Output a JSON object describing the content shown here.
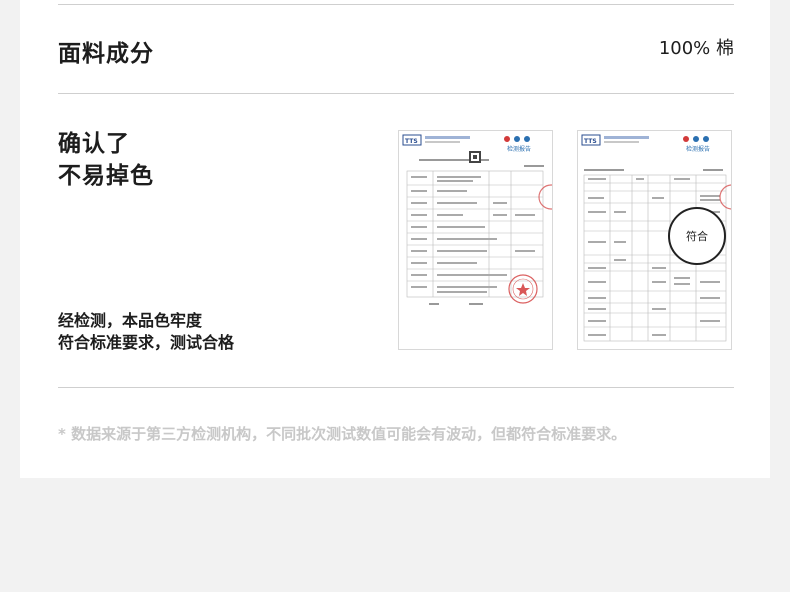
{
  "fabric": {
    "title": "面料成分",
    "value": "100% 棉"
  },
  "confirm": {
    "line1": "确认了",
    "line2": "不易掉色"
  },
  "desc": {
    "line1": "经检测，本品色牢度",
    "line2": "符合标准要求，测试合格"
  },
  "certs": [
    {
      "header": "检测报告",
      "logo": "TTS"
    },
    {
      "header": "检测报告",
      "logo": "TTS",
      "stamp_text": "符合"
    }
  ],
  "footnote": "* 数据来源于第三方检测机构，不同批次测试数值可能会有波动，但都符合标准要求。",
  "colors": {
    "text": "#1d1d1d",
    "muted": "#c8c8c8",
    "divider": "#cfcfcf",
    "background": "#f2f2f2",
    "card": "#ffffff",
    "stamp_red": "#d23a3a"
  }
}
